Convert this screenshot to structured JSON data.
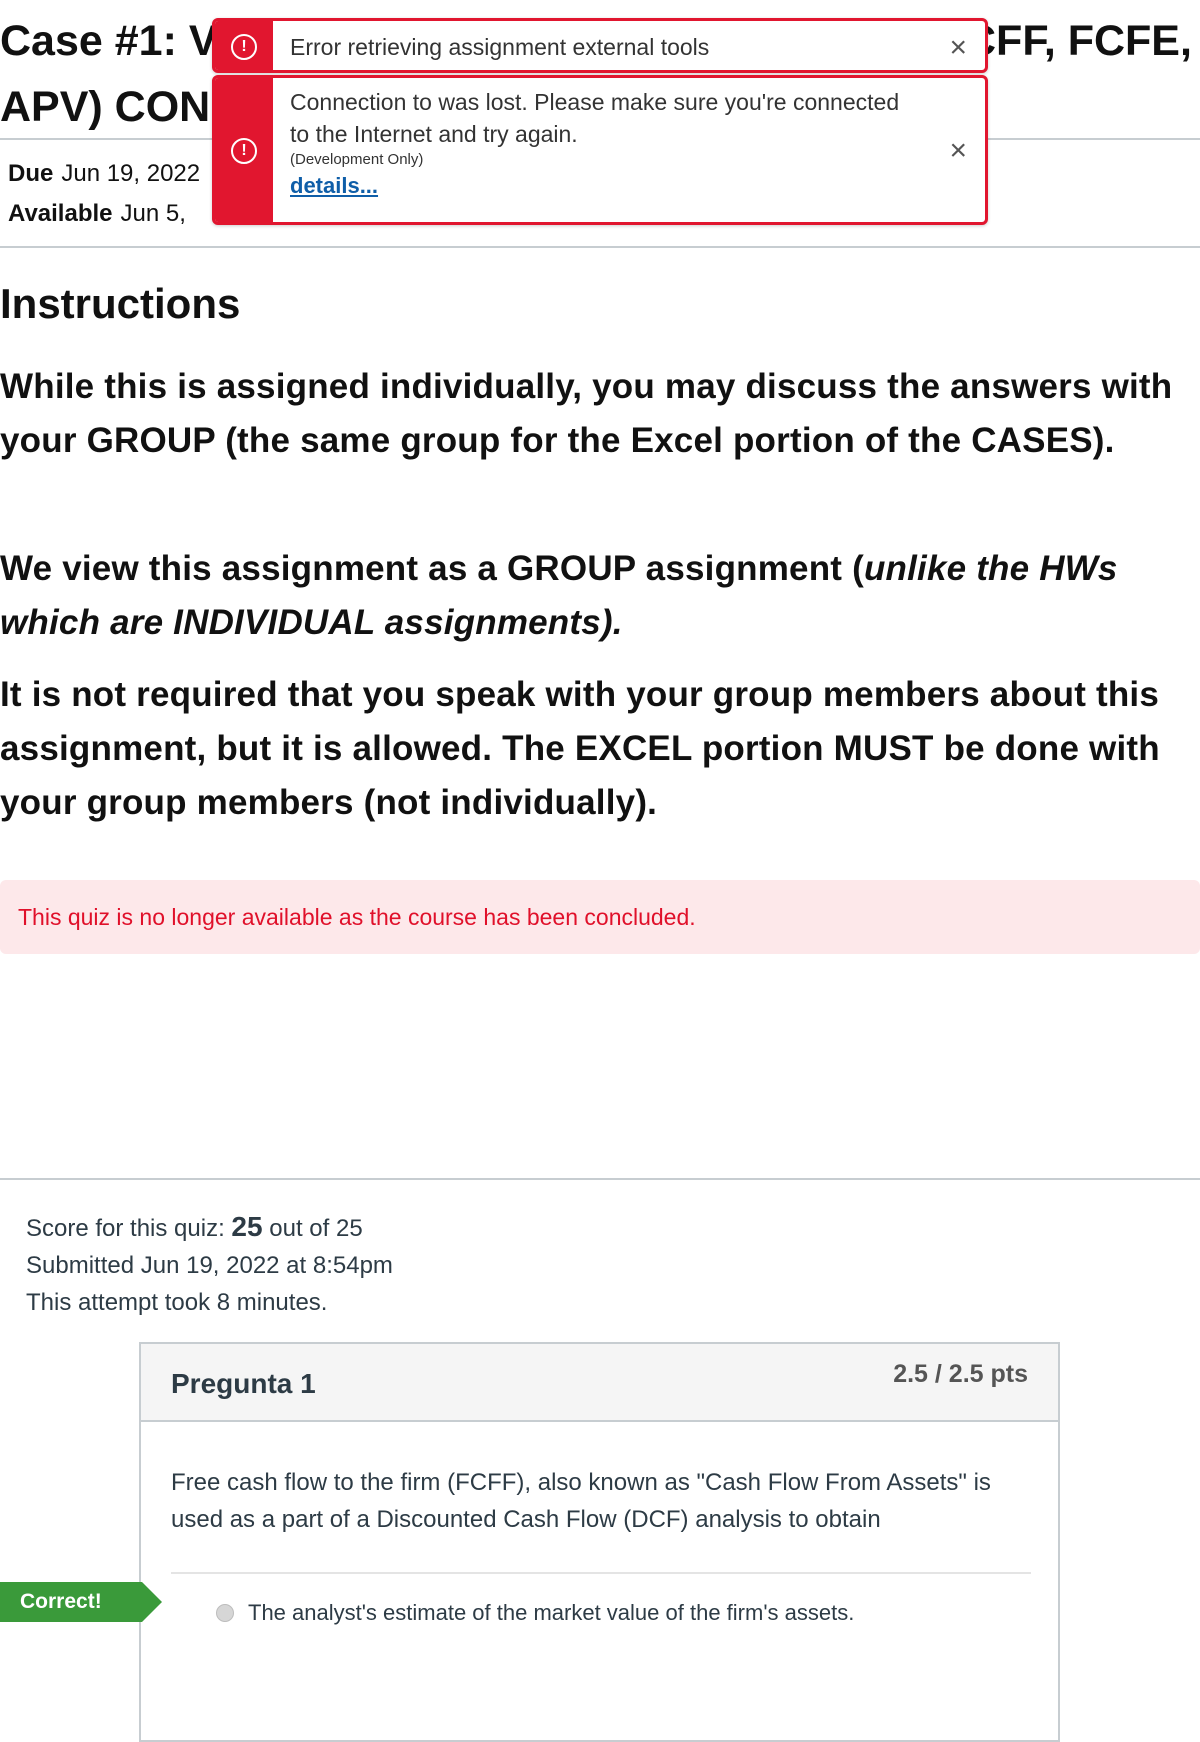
{
  "title": {
    "left_line1": "Case #1: V",
    "left_line2": "APV) CON",
    "right_fragment": "CFF, FCFE,"
  },
  "meta": {
    "due_label": "Due",
    "due_value": "Jun 19, 2022",
    "available_label": "Available",
    "available_value": "Jun 5,"
  },
  "toasts": [
    {
      "message": "Error retrieving assignment external tools",
      "close": "×"
    },
    {
      "message": "Connection to was lost. Please make sure you're connected to the Internet and try again.",
      "dev_note": "(Development Only)",
      "details_link": "details...",
      "close": "×"
    }
  ],
  "instructions": {
    "heading": "Instructions",
    "p1": "While this is assigned individually, you may discuss the answers with your GROUP (the same group for the Excel portion of the CASES).",
    "p2_normal": "We view this assignment as a GROUP assignment (",
    "p2_italic": "unlike the HWs which are INDIVIDUAL assignments).",
    "p3": "It is not required that you speak with your group members about this assignment, but it is allowed.  The EXCEL portion MUST be done with your group members (not individually)."
  },
  "concluded_notice": "This quiz is no longer available as the course has been concluded.",
  "score": {
    "label": "Score for this quiz:",
    "value": "25",
    "out_of": "out of 25",
    "submitted": "Submitted Jun 19, 2022 at 8:54pm",
    "duration": "This attempt took 8 minutes."
  },
  "question": {
    "title": "Pregunta 1",
    "points": "2.5 / 2.5 pts",
    "text": "Free cash flow to the firm (FCFF), also known as \"Cash Flow From Assets\" is used as a part of a Discounted Cash Flow (DCF) analysis to obtain",
    "answer": "The analyst's estimate of the market value of the firm's assets.",
    "correct_label": "Correct!"
  },
  "colors": {
    "error": "#e1162f",
    "correct": "#3a9a3a",
    "concluded_bg": "#fde8ea",
    "link": "#0f5ea8"
  }
}
